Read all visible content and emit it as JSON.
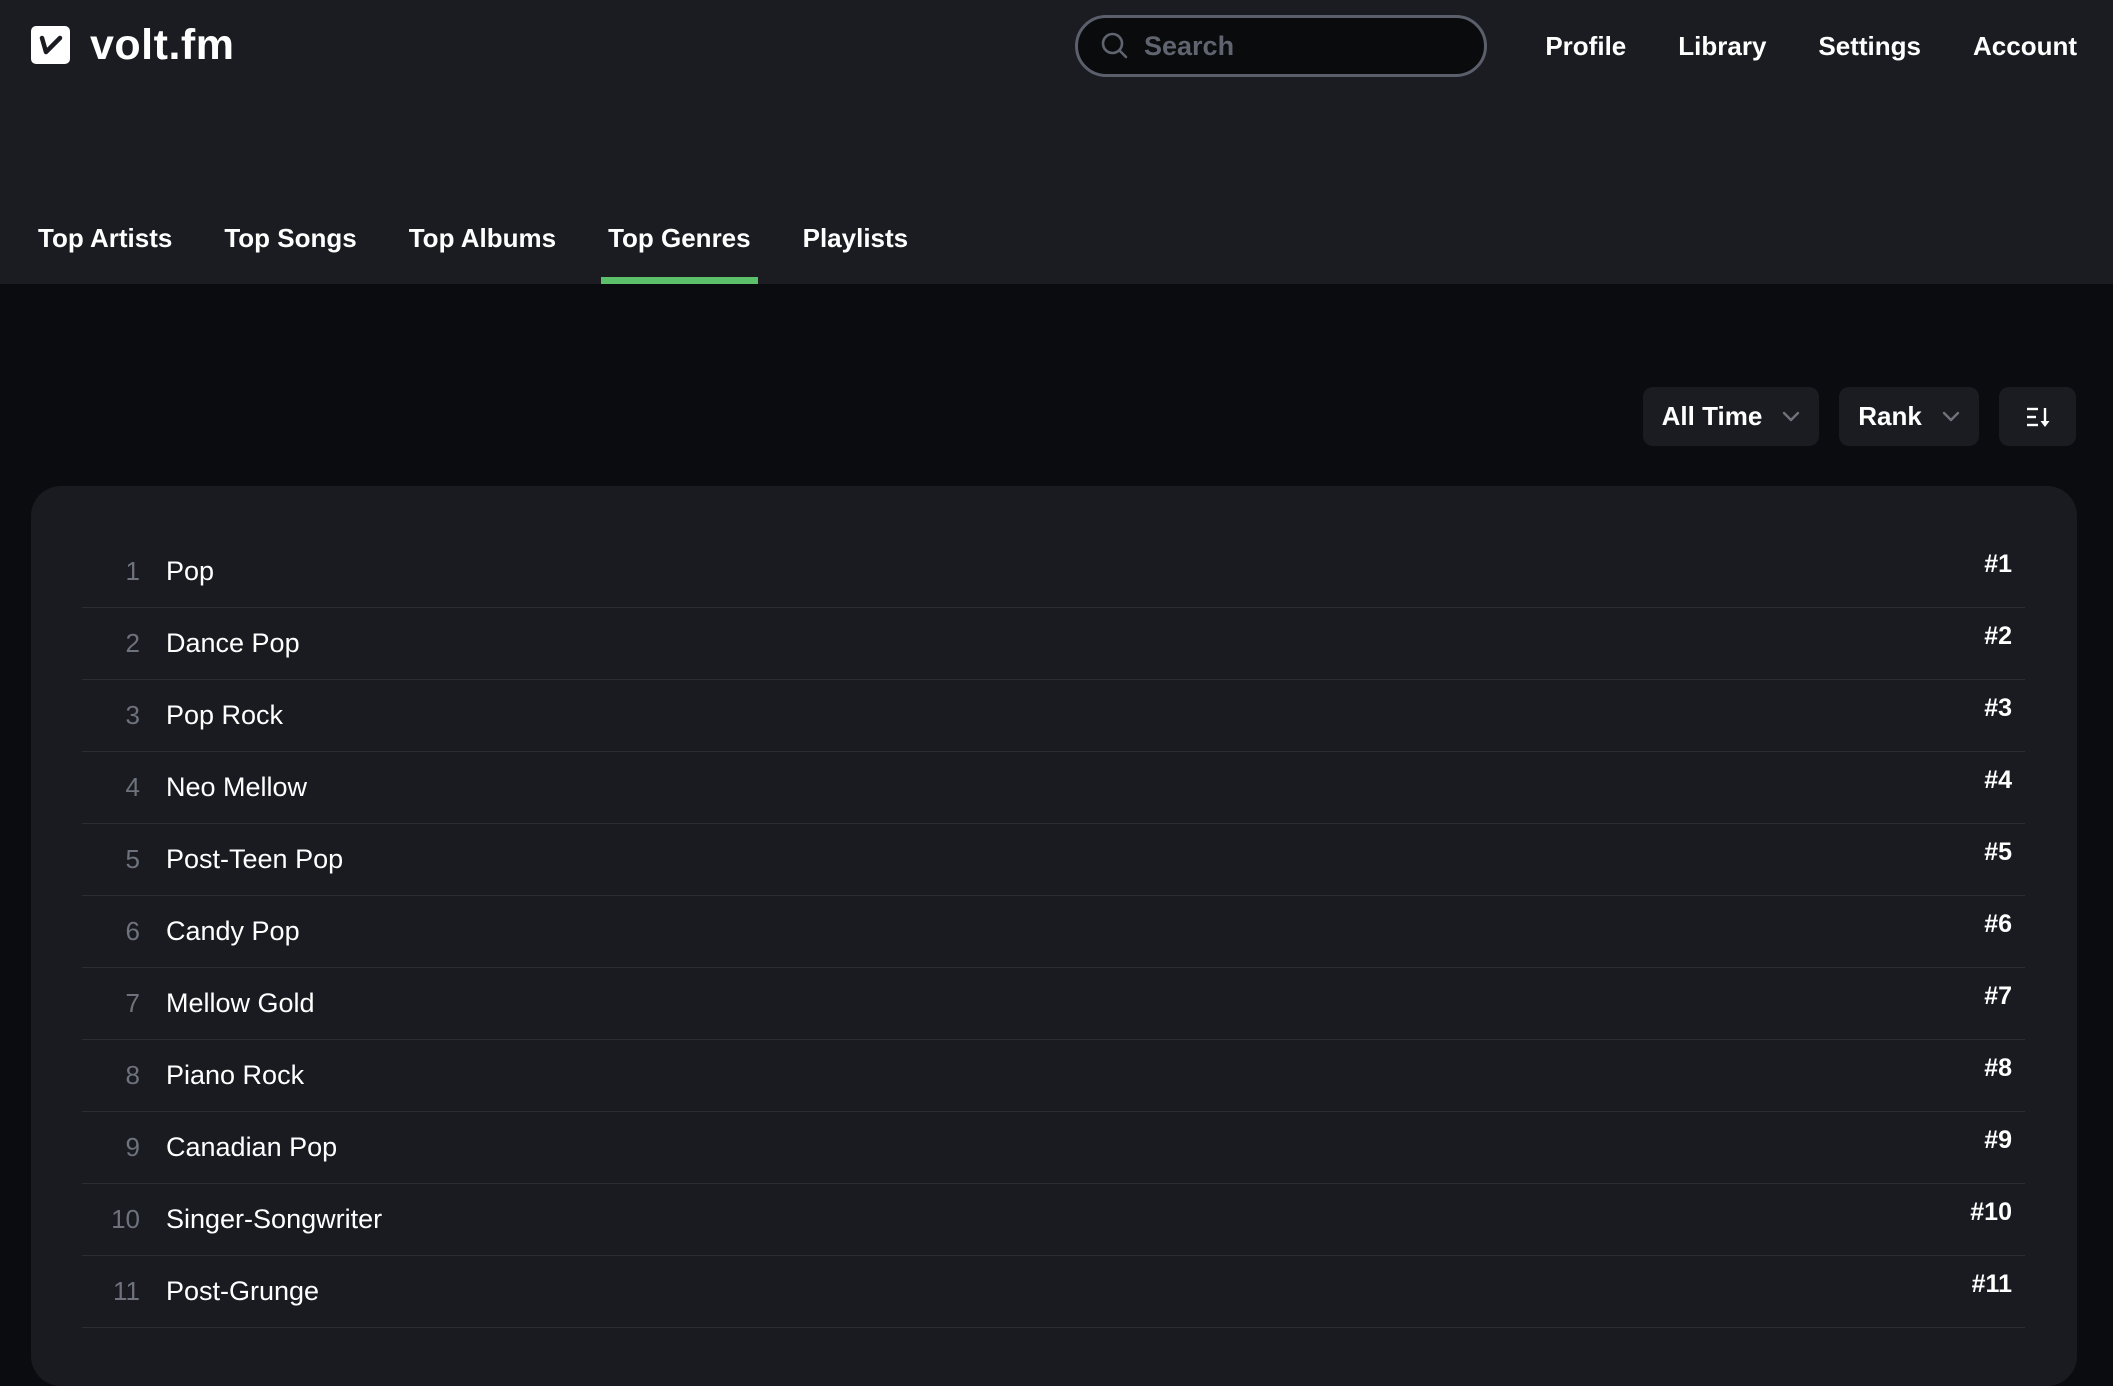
{
  "app": {
    "name": "volt.fm",
    "logo_glyph": "v"
  },
  "search": {
    "placeholder": "Search",
    "value": "",
    "icon": "search-icon"
  },
  "nav": {
    "items": [
      {
        "label": "Profile"
      },
      {
        "label": "Library"
      },
      {
        "label": "Settings"
      },
      {
        "label": "Account"
      }
    ]
  },
  "tabs": {
    "items": [
      {
        "label": "Top Artists",
        "active": false
      },
      {
        "label": "Top Songs",
        "active": false
      },
      {
        "label": "Top Albums",
        "active": false
      },
      {
        "label": "Top Genres",
        "active": true
      },
      {
        "label": "Playlists",
        "active": false
      }
    ],
    "active_color": "#5cbf6a"
  },
  "controls": {
    "time_range": {
      "selected": "All Time",
      "icon": "chevron-down-icon"
    },
    "sort_by": {
      "selected": "Rank",
      "icon": "chevron-down-icon"
    },
    "sort_order": {
      "icon": "sort-descending-icon"
    }
  },
  "genres": [
    {
      "position": "1",
      "name": "Pop",
      "rank": "#1"
    },
    {
      "position": "2",
      "name": "Dance Pop",
      "rank": "#2"
    },
    {
      "position": "3",
      "name": "Pop Rock",
      "rank": "#3"
    },
    {
      "position": "4",
      "name": "Neo Mellow",
      "rank": "#4"
    },
    {
      "position": "5",
      "name": "Post-Teen Pop",
      "rank": "#5"
    },
    {
      "position": "6",
      "name": "Candy Pop",
      "rank": "#6"
    },
    {
      "position": "7",
      "name": "Mellow Gold",
      "rank": "#7"
    },
    {
      "position": "8",
      "name": "Piano Rock",
      "rank": "#8"
    },
    {
      "position": "9",
      "name": "Canadian Pop",
      "rank": "#9"
    },
    {
      "position": "10",
      "name": "Singer-Songwriter",
      "rank": "#10"
    },
    {
      "position": "11",
      "name": "Post-Grunge",
      "rank": "#11"
    }
  ]
}
